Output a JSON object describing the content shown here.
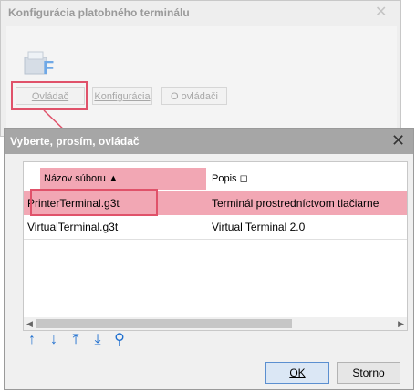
{
  "background_window": {
    "title": "Konfigurácia platobného terminálu",
    "close_glyph": "✕",
    "buttons": [
      {
        "label": "Ovládač",
        "highlighted": true
      },
      {
        "label": "Konfigurácia",
        "highlighted": false
      },
      {
        "label": "O ovládači",
        "highlighted": false
      }
    ],
    "icon": "printer-terminal-icon"
  },
  "dialog": {
    "title": "Vyberte, prosím, ovládač",
    "close_glyph": "✕",
    "columns": {
      "name": "Názov súboru ▲",
      "desc": "Popis ◻"
    },
    "rows": [
      {
        "name": "PrinterTerminal.g3t",
        "desc": "Terminál prostredníctvom tlačiarne",
        "selected": true
      },
      {
        "name": "VirtualTerminal.g3t",
        "desc": "Virtual Terminal 2.0",
        "selected": false
      }
    ],
    "toolbar": [
      {
        "glyph": "↑",
        "icon": "move-up-icon"
      },
      {
        "glyph": "↓",
        "icon": "move-down-icon"
      },
      {
        "glyph": "⤒",
        "icon": "move-top-icon"
      },
      {
        "glyph": "⤓",
        "icon": "move-bottom-icon"
      },
      {
        "glyph": "⚲",
        "icon": "search-icon"
      }
    ],
    "ok_label": "OK",
    "cancel_label": "Storno"
  },
  "colors": {
    "highlight": "#f2a7b4",
    "annotation": "#e0526a",
    "accent": "#1f6fcf"
  }
}
